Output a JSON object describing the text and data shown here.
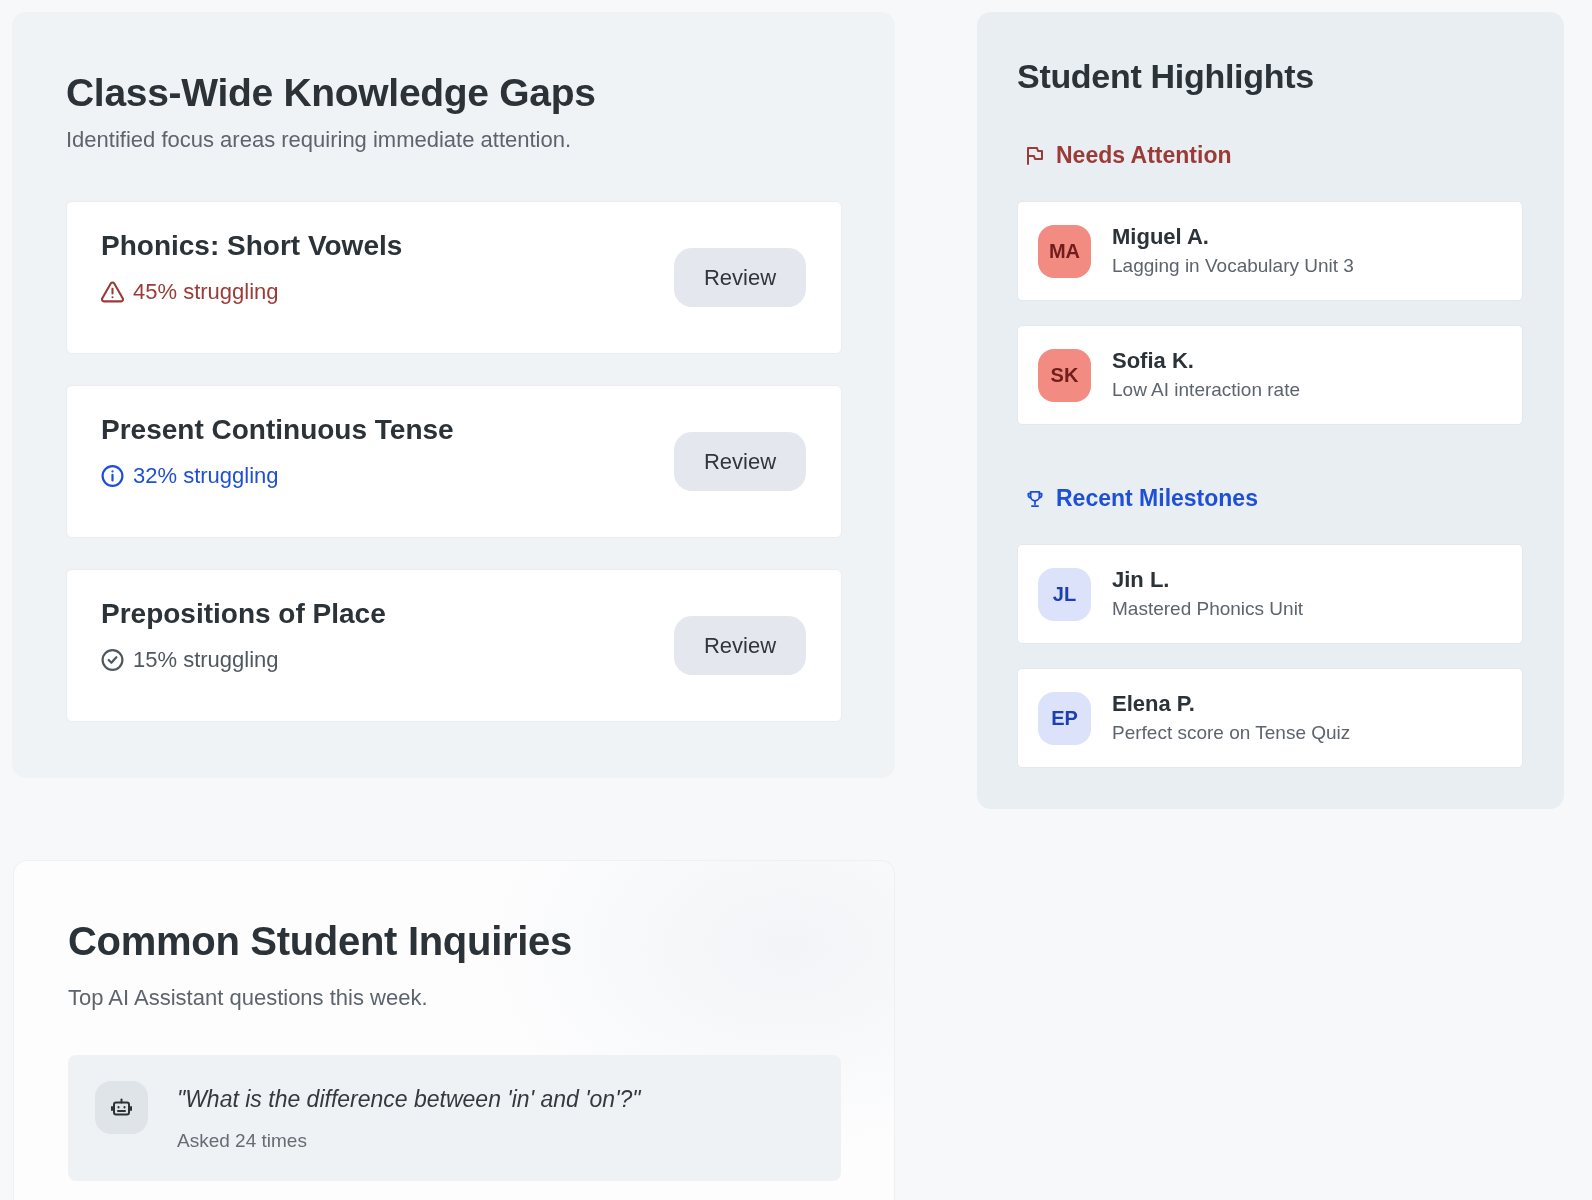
{
  "knowledge_gaps": {
    "title": "Class-Wide Knowledge Gaps",
    "subtitle": "Identified focus areas requiring immediate attention.",
    "topics": [
      {
        "name": "Phonics: Short Vowels",
        "kind": "warning",
        "status": "45% struggling",
        "button": "Review"
      },
      {
        "name": "Present Continuous Tense",
        "kind": "info",
        "status": "32% struggling",
        "button": "Review"
      },
      {
        "name": "Prepositions of Place",
        "kind": "ok",
        "status": "15% struggling",
        "button": "Review"
      }
    ]
  },
  "student_highlights": {
    "title": "Student Highlights",
    "sections": [
      {
        "kind": "attention",
        "heading": "Needs Attention",
        "students": [
          {
            "initials": "MA",
            "name": "Miguel A.",
            "note": "Lagging in Vocabulary Unit 3"
          },
          {
            "initials": "SK",
            "name": "Sofia K.",
            "note": "Low AI interaction rate"
          }
        ]
      },
      {
        "kind": "milestone",
        "heading": "Recent Milestones",
        "students": [
          {
            "initials": "JL",
            "name": "Jin L.",
            "note": "Mastered Phonics Unit"
          },
          {
            "initials": "EP",
            "name": "Elena P.",
            "note": "Perfect score on Tense Quiz"
          }
        ]
      }
    ]
  },
  "common_inquiries": {
    "title": "Common Student Inquiries",
    "subtitle": "Top AI Assistant questions this week.",
    "questions": [
      {
        "text": "\"What is the difference between 'in' and 'on'?\"",
        "count": "Asked 24 times"
      }
    ]
  }
}
